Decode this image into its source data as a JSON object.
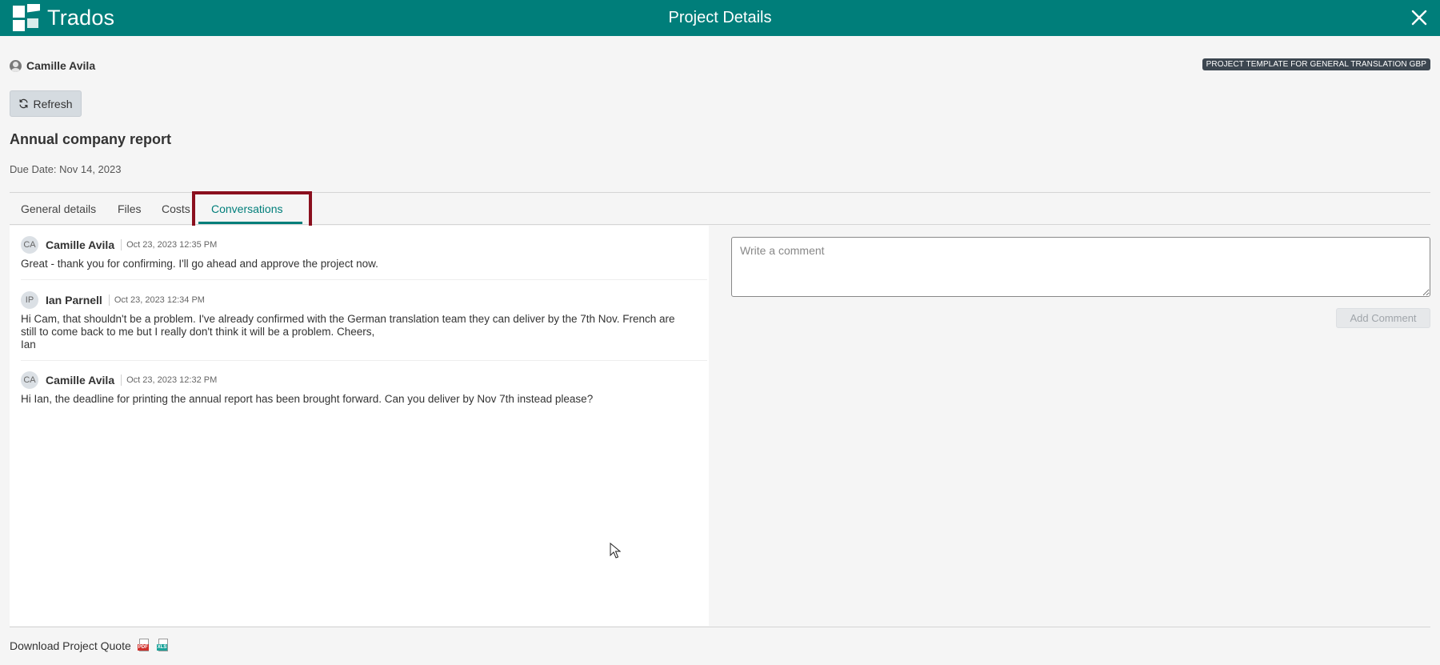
{
  "app": {
    "brand": "Trados",
    "page_title": "Project Details",
    "header_color": "#007e7a"
  },
  "user": {
    "name": "Camille Avila"
  },
  "template_badge": "PROJECT TEMPLATE FOR GENERAL TRANSLATION GBP",
  "toolbar": {
    "refresh_label": "Refresh"
  },
  "project": {
    "title": "Annual company report",
    "due_date": "Due Date: Nov 14, 2023"
  },
  "tabs": [
    {
      "label": "General details",
      "active": false
    },
    {
      "label": "Files",
      "active": false
    },
    {
      "label": "Costs",
      "active": false
    },
    {
      "label": "Conversations",
      "active": true
    }
  ],
  "messages": [
    {
      "initials": "CA",
      "author": "Camille Avila",
      "timestamp": "Oct 23, 2023 12:35 PM",
      "body": "Great - thank you for confirming. I'll go ahead and approve the project now."
    },
    {
      "initials": "IP",
      "author": "Ian Parnell",
      "timestamp": "Oct 23, 2023 12:34 PM",
      "body": "Hi Cam, that shouldn't be a problem. I've already confirmed with the German translation team they can deliver by the 7th Nov. French are still to come back to me but I really don't think it will be a problem. Cheers,\nIan"
    },
    {
      "initials": "CA",
      "author": "Camille Avila",
      "timestamp": "Oct 23, 2023 12:32 PM",
      "body": "Hi Ian, the deadline for printing the annual report has been brought forward. Can you deliver by Nov 7th instead please?"
    }
  ],
  "comment": {
    "placeholder": "Write a comment",
    "value": "",
    "add_label": "Add Comment"
  },
  "footer": {
    "download_label": "Download Project Quote",
    "pdf_icon": "PDF",
    "xls_icon": "XLS"
  },
  "colors": {
    "accent": "#007e7a",
    "highlight": "#8a0f1e",
    "pdf": "#d0312d",
    "xls": "#1aa39a"
  }
}
